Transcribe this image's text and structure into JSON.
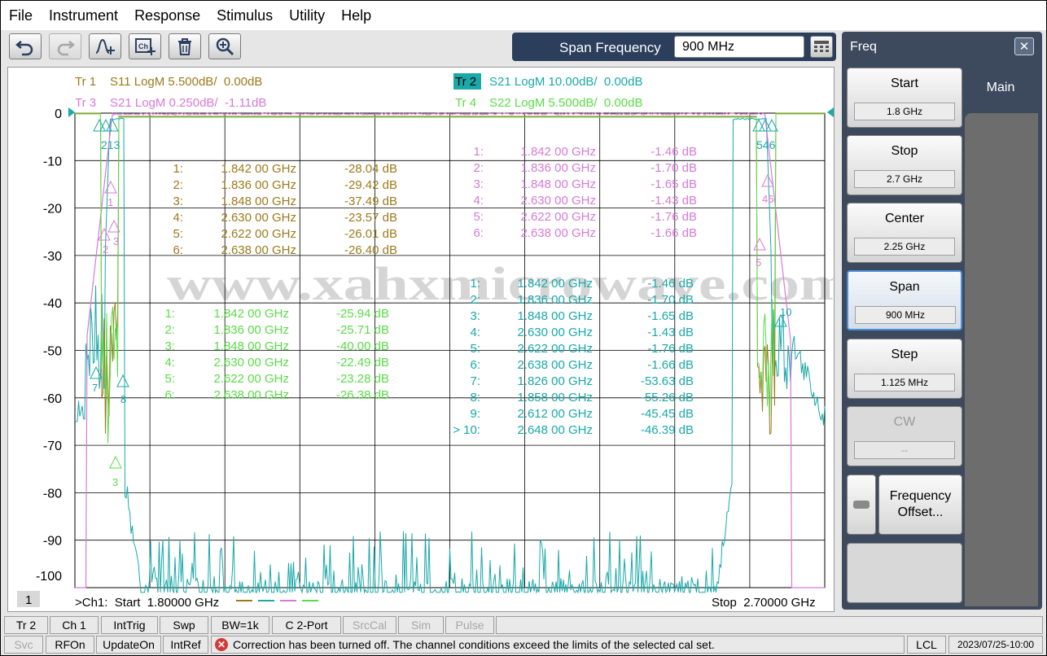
{
  "menu": [
    "File",
    "Instrument",
    "Response",
    "Stimulus",
    "Utility",
    "Help"
  ],
  "toolbar": {
    "buttons": [
      "undo-icon",
      "redo-icon",
      "add-trace-icon",
      "add-channel-icon",
      "delete-icon",
      "zoom-icon"
    ]
  },
  "entry": {
    "label": "Span Frequency",
    "value": "900 MHz"
  },
  "traces": [
    {
      "id": "Tr 1",
      "desc": "S11 LogM 5.500dB/  0.00dB",
      "color": "#9c7a1c",
      "active": false
    },
    {
      "id": "Tr 2",
      "desc": "S21 LogM 10.00dB/  0.00dB",
      "color": "#1aa8a8",
      "active": true
    },
    {
      "id": "Tr 3",
      "desc": "S21 LogM 0.250dB/  -1.11dB",
      "color": "#d67ad6",
      "active": false
    },
    {
      "id": "Tr 4",
      "desc": "S22 LogM 5.500dB/  0.00dB",
      "color": "#5adc48",
      "active": false
    }
  ],
  "y_ticks": [
    "0",
    "-10",
    "-20",
    "-30",
    "-40",
    "-50",
    "-60",
    "-70",
    "-80",
    "-90",
    "-100"
  ],
  "marker_tables": {
    "tr1": {
      "color": "#9c7a1c",
      "rows": [
        [
          "1:",
          "1.842 00 GHz",
          "-28.04 dB"
        ],
        [
          "2:",
          "1.836 00 GHz",
          "-29.42 dB"
        ],
        [
          "3:",
          "1.848 00 GHz",
          "-37.49 dB"
        ],
        [
          "4:",
          "2.630 00 GHz",
          "-23.57 dB"
        ],
        [
          "5:",
          "2.622 00 GHz",
          "-26.01 dB"
        ],
        [
          "6:",
          "2.638 00 GHz",
          "-26.40 dB"
        ]
      ]
    },
    "tr4": {
      "color": "#5adc48",
      "rows": [
        [
          "1:",
          "1.842 00 GHz",
          "-25.94 dB"
        ],
        [
          "2:",
          "1.836 00 GHz",
          "-25.71 dB"
        ],
        [
          "3:",
          "1.848 00 GHz",
          "-40.00 dB"
        ],
        [
          "4:",
          "2.630 00 GHz",
          "-22.49 dB"
        ],
        [
          "5:",
          "2.622 00 GHz",
          "-23.28 dB"
        ],
        [
          "6:",
          "2.638 00 GHz",
          "-26.38 dB"
        ]
      ]
    },
    "tr3": {
      "color": "#d67ad6",
      "rows": [
        [
          "1:",
          "1.842 00 GHz",
          "-1.46 dB"
        ],
        [
          "2:",
          "1.836 00 GHz",
          "-1.70 dB"
        ],
        [
          "3:",
          "1.848 00 GHz",
          "-1.65 dB"
        ],
        [
          "4:",
          "2.630 00 GHz",
          "-1.43 dB"
        ],
        [
          "5:",
          "2.622 00 GHz",
          "-1.76 dB"
        ],
        [
          "6:",
          "2.638 00 GHz",
          "-1.66 dB"
        ]
      ]
    },
    "tr2": {
      "color": "#1aa8a8",
      "rows": [
        [
          "1:",
          "1.842 00 GHz",
          "-1.46 dB"
        ],
        [
          "2:",
          "1.836 00 GHz",
          "-1.70 dB"
        ],
        [
          "3:",
          "1.848 00 GHz",
          "-1.65 dB"
        ],
        [
          "4:",
          "2.630 00 GHz",
          "-1.43 dB"
        ],
        [
          "5:",
          "2.622 00 GHz",
          "-1.76 dB"
        ],
        [
          "6:",
          "2.638 00 GHz",
          "-1.66 dB"
        ],
        [
          "7:",
          "1.826 00 GHz",
          "-53.63 dB"
        ],
        [
          "8:",
          "1.858 00 GHz",
          "-55.26 dB"
        ],
        [
          "9:",
          "2.612 00 GHz",
          "-45.45 dB"
        ],
        [
          "> 10:",
          "2.648 00 GHz",
          "-46.39 dB"
        ]
      ]
    }
  },
  "watermark": "www.xahxmicrowave.com",
  "channel_number": "1",
  "start_label": ">Ch1:  Start  1.80000 GHz",
  "stop_label": "Stop  2.70000 GHz",
  "marker_labels": {
    "left_cluster": "213",
    "right_cluster": "546",
    "tr3_right": "46",
    "tr3_right_5": "5",
    "tr2_right_10": "10",
    "tr2_left_7": "7",
    "tr2_left_8": "8",
    "tr3_left_1": "1",
    "tr3_left_2": "2",
    "tr3_left_3": "3",
    "tr4_left_3": "3"
  },
  "panel": {
    "title": "Freq",
    "tab": "Main",
    "softkeys": [
      {
        "label": "Start",
        "value": "1.8 GHz",
        "active": false,
        "disabled": false
      },
      {
        "label": "Stop",
        "value": "2.7 GHz",
        "active": false,
        "disabled": false
      },
      {
        "label": "Center",
        "value": "2.25 GHz",
        "active": false,
        "disabled": false
      },
      {
        "label": "Span",
        "value": "900 MHz",
        "active": true,
        "disabled": false
      },
      {
        "label": "Step",
        "value": "1.125 MHz",
        "active": false,
        "disabled": false
      },
      {
        "label": "CW",
        "value": "--",
        "active": false,
        "disabled": true
      }
    ],
    "offset_label_1": "Frequency",
    "offset_label_2": "Offset..."
  },
  "status1": [
    "Tr 2",
    "Ch 1",
    "IntTrig",
    "Swp",
    "BW=1k",
    "C  2-Port",
    "SrcCal",
    "Sim",
    "Pulse"
  ],
  "status1_dim": [
    false,
    false,
    false,
    false,
    false,
    false,
    true,
    true,
    true
  ],
  "status2": {
    "svc": "Svc",
    "rfon": "RFOn",
    "updateon": "UpdateOn",
    "intref": "IntRef",
    "message": "Correction has been turned off. The channel conditions exceed the limits of the selected cal set.",
    "lcl": "LCL",
    "datetime": "2023/07/25-10:00"
  },
  "colors": {
    "tr1": "#9c7a1c",
    "tr2": "#1aa8a8",
    "tr3": "#d67ad6",
    "tr4": "#5adc48",
    "panel": "#3d4a5e"
  }
}
